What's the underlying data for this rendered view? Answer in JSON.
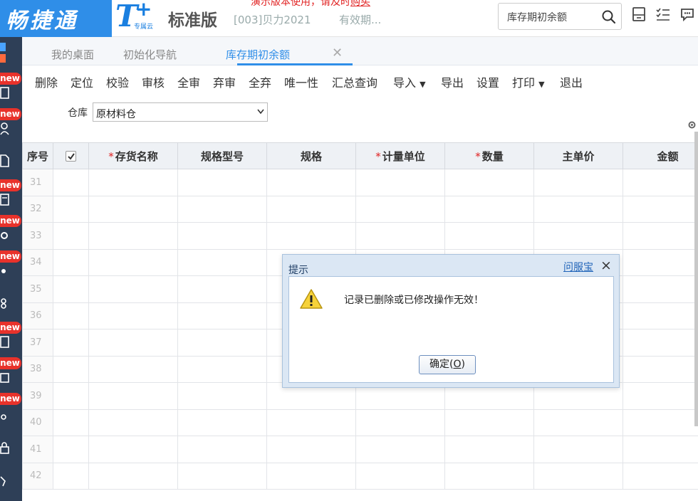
{
  "header": {
    "brand": "畅捷通",
    "tplus_mark": "T",
    "tplus_plus": "+",
    "tplus_sub": "专属云",
    "edition": "标准版",
    "company": "[003]贝力2021",
    "validity": "有效期...",
    "demo_notice_prefix": "演示版本使用，请及时",
    "demo_notice_link": "购买",
    "search_value": "库存期初余额"
  },
  "rail": {
    "badge": "new"
  },
  "tabs": [
    {
      "label": "我的桌面"
    },
    {
      "label": "初始化导航"
    },
    {
      "label": "库存期初余额"
    }
  ],
  "toolbar": [
    {
      "label": "删除"
    },
    {
      "label": "定位"
    },
    {
      "label": "校验"
    },
    {
      "label": "审核"
    },
    {
      "label": "全审"
    },
    {
      "label": "弃审"
    },
    {
      "label": "全弃"
    },
    {
      "label": "唯一性"
    },
    {
      "label": "汇总查询"
    },
    {
      "label": "导入"
    },
    {
      "label": "导出"
    },
    {
      "label": "设置"
    },
    {
      "label": "打印"
    },
    {
      "label": "退出"
    }
  ],
  "filter": {
    "label": "仓库",
    "value": "原材料仓"
  },
  "grid": {
    "columns": {
      "seq": "序号",
      "name": "存货名称",
      "spec_model": "规格型号",
      "spec": "规格",
      "unit": "计量单位",
      "qty": "数量",
      "price": "主单价",
      "amount": "金额"
    },
    "rows": [
      "31",
      "32",
      "33",
      "34",
      "35",
      "36",
      "37",
      "38",
      "39",
      "40",
      "41",
      "42"
    ]
  },
  "dialog": {
    "title": "提示",
    "help_link": "问服宝",
    "message": "记录已删除或已修改操作无效！",
    "ok_label": "确定(",
    "ok_key": "O",
    "ok_close": ")"
  }
}
